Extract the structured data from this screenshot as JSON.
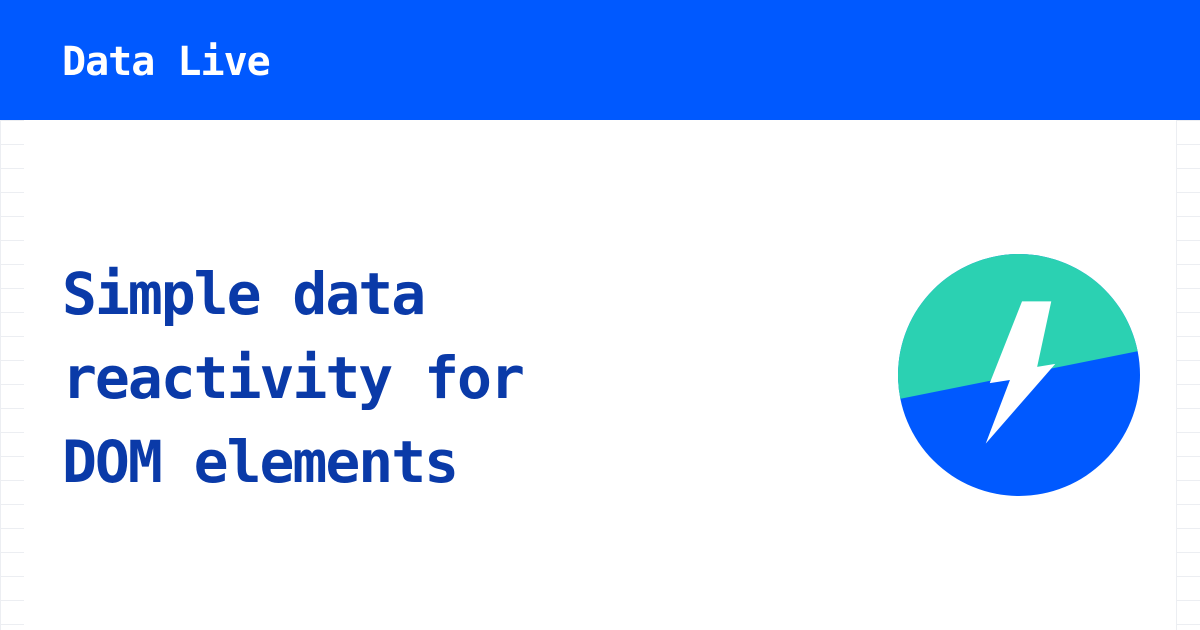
{
  "header": {
    "brand": "Data Live",
    "background_color": "#0059ff"
  },
  "hero": {
    "tagline_lines": [
      "Simple data",
      "reactivity for",
      "DOM elements"
    ],
    "text_color": "#0a3aa8"
  },
  "logo": {
    "icon": "lightning-bolt-icon",
    "top_color": "#2bd1b2",
    "bottom_color": "#0059ff",
    "bolt_color": "#ffffff"
  }
}
